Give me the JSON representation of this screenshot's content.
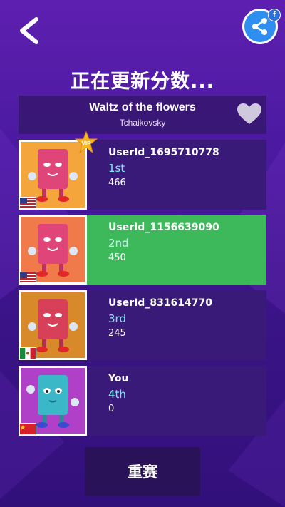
{
  "header": {
    "title": "正在更新分数...",
    "facebook_badge": "f"
  },
  "song": {
    "title": "Waltz of the flowers",
    "artist": "Tchaikovsky"
  },
  "leaderboard": [
    {
      "name": "UserId_1695710778",
      "rank": "1st",
      "score": "466",
      "flag": "us-flag-icon",
      "avatar_color": "#e0457a",
      "bg_color": "#f3a23a",
      "vip": true
    },
    {
      "name": "UserId_1156639090",
      "rank": "2nd",
      "score": "450",
      "flag": "us-flag-icon",
      "avatar_color": "#e0457a",
      "bg_color": "#f07a4a"
    },
    {
      "name": "UserId_831614770",
      "rank": "3rd",
      "score": "245",
      "flag": "mexico-flag-icon",
      "avatar_color": "#d8405a",
      "bg_color": "#d88a2a"
    },
    {
      "name": "You",
      "rank": "4th",
      "score": "0",
      "flag": "china-flag-icon",
      "avatar_color": "#3ab8c8",
      "bg_color": "#b040c8"
    }
  ],
  "vip_label": "VIP",
  "restart_label": "重赛",
  "colors": {
    "highlight": "#3db85a",
    "row": "#3a1a78",
    "rank_text": "#7fe7f0"
  }
}
